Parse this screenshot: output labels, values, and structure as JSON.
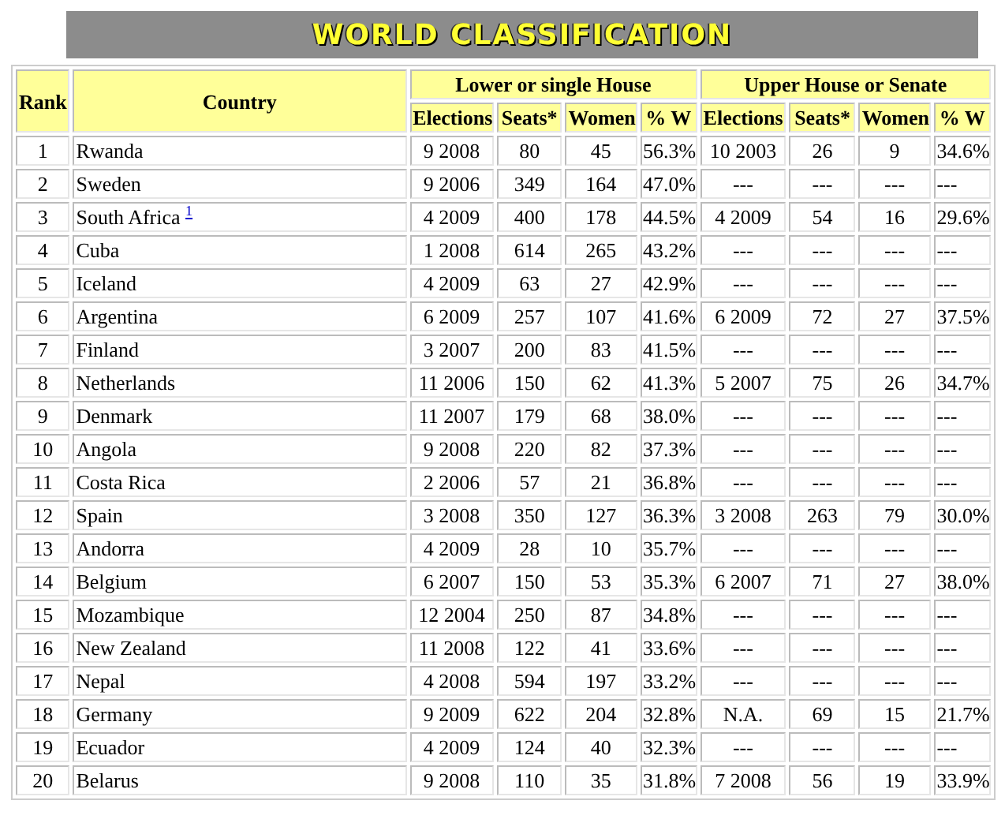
{
  "banner": {
    "title": "WORLD CLASSIFICATION"
  },
  "table": {
    "columns": {
      "rank": "Rank",
      "country": "Country",
      "groups": [
        {
          "title": "Lower or single House",
          "columns": [
            "Elections",
            "Seats*",
            "Women",
            "% W"
          ]
        },
        {
          "title": "Upper House or Senate",
          "columns": [
            "Elections",
            "Seats*",
            "Women",
            "% W"
          ]
        }
      ]
    },
    "rows": [
      {
        "rank": "1",
        "country": "Rwanda",
        "cells": [
          "9 2008",
          "80",
          "45",
          "56.3%",
          "10 2003",
          "26",
          "9",
          "34.6%"
        ]
      },
      {
        "rank": "2",
        "country": "Sweden",
        "cells": [
          "9 2006",
          "349",
          "164",
          "47.0%",
          "---",
          "---",
          "---",
          "---"
        ]
      },
      {
        "rank": "3",
        "country": "South Africa",
        "footnote": "1",
        "cells": [
          "4 2009",
          "400",
          "178",
          "44.5%",
          "4 2009",
          "54",
          "16",
          "29.6%"
        ]
      },
      {
        "rank": "4",
        "country": "Cuba",
        "cells": [
          "1 2008",
          "614",
          "265",
          "43.2%",
          "---",
          "---",
          "---",
          "---"
        ]
      },
      {
        "rank": "5",
        "country": "Iceland",
        "cells": [
          "4 2009",
          "63",
          "27",
          "42.9%",
          "---",
          "---",
          "---",
          "---"
        ]
      },
      {
        "rank": "6",
        "country": "Argentina",
        "cells": [
          "6 2009",
          "257",
          "107",
          "41.6%",
          "6 2009",
          "72",
          "27",
          "37.5%"
        ]
      },
      {
        "rank": "7",
        "country": "Finland",
        "cells": [
          "3 2007",
          "200",
          "83",
          "41.5%",
          "---",
          "---",
          "---",
          "---"
        ]
      },
      {
        "rank": "8",
        "country": "Netherlands",
        "cells": [
          "11 2006",
          "150",
          "62",
          "41.3%",
          "5 2007",
          "75",
          "26",
          "34.7%"
        ]
      },
      {
        "rank": "9",
        "country": "Denmark",
        "cells": [
          "11 2007",
          "179",
          "68",
          "38.0%",
          "---",
          "---",
          "---",
          "---"
        ]
      },
      {
        "rank": "10",
        "country": "Angola",
        "cells": [
          "9 2008",
          "220",
          "82",
          "37.3%",
          "---",
          "---",
          "---",
          "---"
        ]
      },
      {
        "rank": "11",
        "country": "Costa Rica",
        "cells": [
          "2 2006",
          "57",
          "21",
          "36.8%",
          "---",
          "---",
          "---",
          "---"
        ]
      },
      {
        "rank": "12",
        "country": "Spain",
        "cells": [
          "3 2008",
          "350",
          "127",
          "36.3%",
          "3 2008",
          "263",
          "79",
          "30.0%"
        ]
      },
      {
        "rank": "13",
        "country": "Andorra",
        "cells": [
          "4 2009",
          "28",
          "10",
          "35.7%",
          "---",
          "---",
          "---",
          "---"
        ]
      },
      {
        "rank": "14",
        "country": "Belgium",
        "cells": [
          "6 2007",
          "150",
          "53",
          "35.3%",
          "6 2007",
          "71",
          "27",
          "38.0%"
        ]
      },
      {
        "rank": "15",
        "country": "Mozambique",
        "cells": [
          "12 2004",
          "250",
          "87",
          "34.8%",
          "---",
          "---",
          "---",
          "---"
        ]
      },
      {
        "rank": "16",
        "country": "New Zealand",
        "cells": [
          "11 2008",
          "122",
          "41",
          "33.6%",
          "---",
          "---",
          "---",
          "---"
        ]
      },
      {
        "rank": "17",
        "country": "Nepal",
        "cells": [
          "4 2008",
          "594",
          "197",
          "33.2%",
          "---",
          "---",
          "---",
          "---"
        ]
      },
      {
        "rank": "18",
        "country": "Germany",
        "cells": [
          "9 2009",
          "622",
          "204",
          "32.8%",
          "N.A.",
          "69",
          "15",
          "21.7%"
        ]
      },
      {
        "rank": "19",
        "country": "Ecuador",
        "cells": [
          "4 2009",
          "124",
          "40",
          "32.3%",
          "---",
          "---",
          "---",
          "---"
        ]
      },
      {
        "rank": "20",
        "country": "Belarus",
        "cells": [
          "9 2008",
          "110",
          "35",
          "31.8%",
          "7 2008",
          "56",
          "19",
          "33.9%"
        ]
      }
    ]
  }
}
